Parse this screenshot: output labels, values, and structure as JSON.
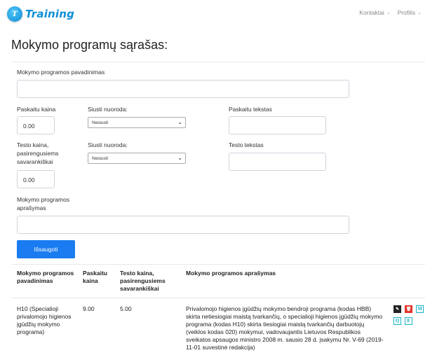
{
  "nav": {
    "brand_badge": "T",
    "brand_name": "Training",
    "contacts": "Kontaktai",
    "profile": "Profilis"
  },
  "page_title": "Mokymo programų sąrašas:",
  "form": {
    "name_label": "Mokymo programos pavadinimas",
    "name_value": "",
    "lecture_price_label": "Paskaitu kaina",
    "lecture_price_value": "0.00",
    "send_link_label_1": "Siusti nuoroda:",
    "send_link_value_1": "Nesiusti",
    "lecture_text_label": "Paskaitu tekstas",
    "test_price_label_l1": "Testo kaina,",
    "test_price_label_l2": "pasirengusiems",
    "test_price_label_l3": "savarankiškai",
    "test_price_value": "0.00",
    "send_link_label_2": "Siusti nuoroda:",
    "send_link_value_2": "Nesiusti",
    "test_text_label": "Testo tekstas",
    "desc_label_l1": "Mokymo programos",
    "desc_label_l2": "aprašymas",
    "save_label": "Išsaugoti"
  },
  "table": {
    "headers": {
      "name_l1": "Mokymo programos",
      "name_l2": "pavadinimas",
      "price_l1": "Paskaitu",
      "price_l2": "kaina",
      "test_l1": "Testo kaina,",
      "test_l2": "pasirengusiems",
      "test_l3": "savarankiškai",
      "desc": "Mokymo programos aprašymas"
    },
    "rows": [
      {
        "name_l1": "H10 (Specialioji",
        "name_l2": "privalomojo higienos",
        "name_l3": "įgūdžių mokymo",
        "name_l4": "programa)",
        "price": "9.00",
        "test_price": "5.00",
        "desc_l1": "Privalomojo higienos įgūdžių mokymo bendroji programa (kodas HBB)",
        "desc_l2": "skirta netiesiogiai maistą tvarkančių, o specialioji higienos įgūdžių mokymo",
        "desc_l3": "programa (kodas H10) skirta tiesiogiai maistą tvarkančių darbuotojų",
        "desc_l4": "(veiklos kodas 020) mokymui, vadovaujantis Lietuvos Respublikos",
        "desc_l5": "sveikatos apsaugos ministro 2008 m. sausio 28 d. įsakymu Nr. V-69 (2019-",
        "desc_l6": "11-01 suvestinė redakcija)",
        "actions": {
          "edit": "✎",
          "delete": "🗑",
          "m": "M",
          "q": "Q",
          "e": "E"
        }
      }
    ]
  },
  "colors": {
    "brand": "#0d8fd6",
    "primary": "#1a7cf0",
    "danger": "#e0342b",
    "info": "#19b3c7"
  }
}
